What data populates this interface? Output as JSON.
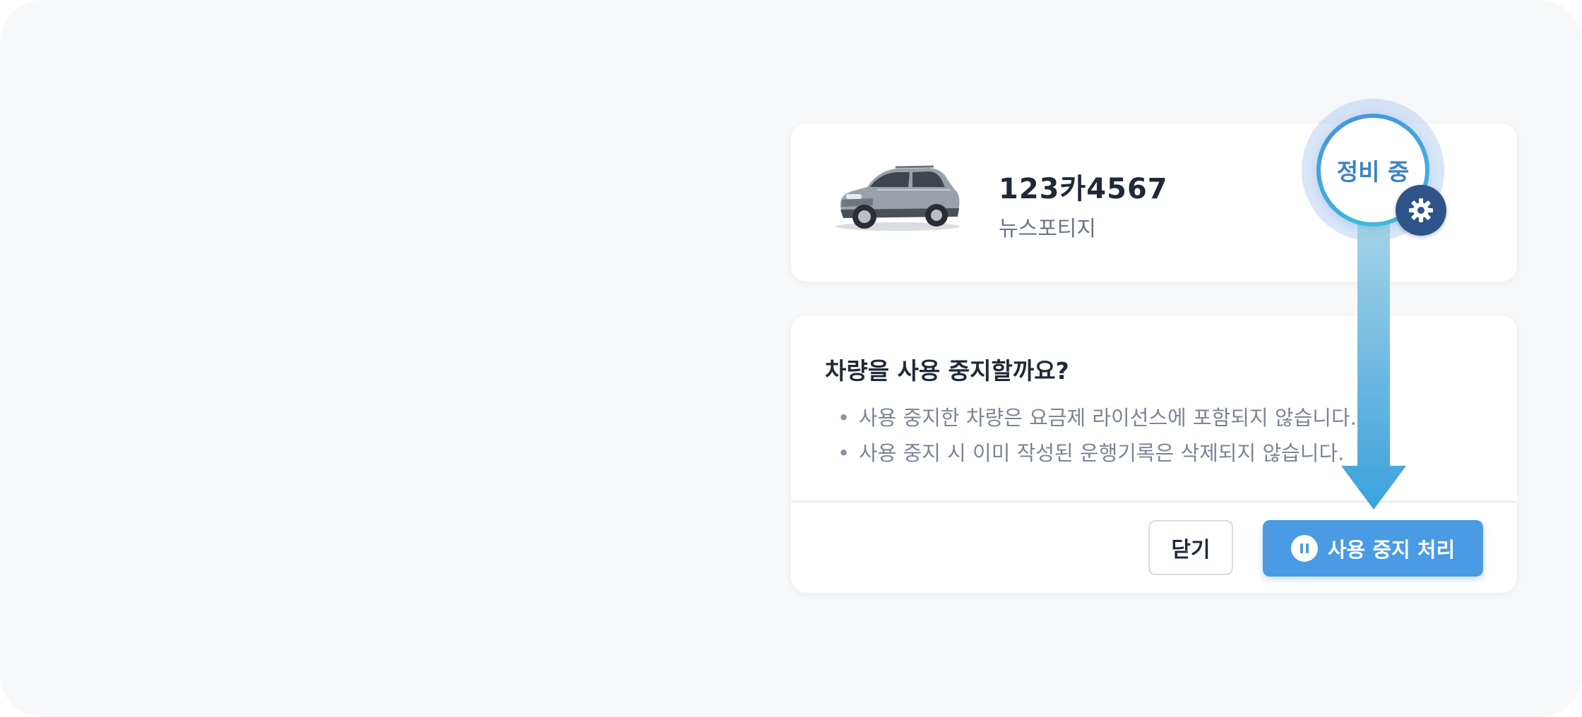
{
  "vehicle": {
    "plate": "123카4567",
    "model": "뉴스포티지",
    "image": "suv-car-photo"
  },
  "status_badge": {
    "label": "정비 중",
    "icon": "gear-icon"
  },
  "dialog": {
    "title": "차량을 사용 중지할까요?",
    "notices": [
      "사용 중지한 차량은 요금제 라이선스에 포함되지 않습니다.",
      "사용 중지 시 이미 작성된 운행기록은 삭제되지 않습니다."
    ],
    "close_label": "닫기",
    "suspend_label": "사용 중지 처리",
    "suspend_icon": "pause-icon"
  },
  "colors": {
    "accent": "#4a9be3",
    "badge_ring": "#3c82c8",
    "gear_bg": "#2e5489",
    "arrow_top": "#a8d4e6",
    "arrow_bottom": "#3aa2dd"
  }
}
